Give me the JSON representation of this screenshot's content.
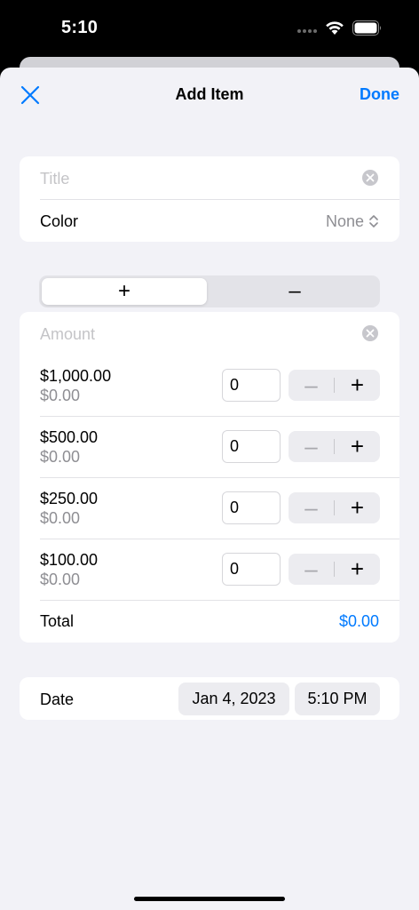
{
  "status_bar": {
    "time": "5:10"
  },
  "nav": {
    "title": "Add Item",
    "done_label": "Done"
  },
  "form": {
    "title_placeholder": "Title",
    "color_label": "Color",
    "color_value": "None"
  },
  "segmented": {
    "options": [
      "+",
      "–"
    ],
    "selected_index": 0
  },
  "amount": {
    "placeholder": "Amount",
    "rows": [
      {
        "denomination": "$1,000.00",
        "subtotal": "$0.00",
        "quantity": "0"
      },
      {
        "denomination": "$500.00",
        "subtotal": "$0.00",
        "quantity": "0"
      },
      {
        "denomination": "$250.00",
        "subtotal": "$0.00",
        "quantity": "0"
      },
      {
        "denomination": "$100.00",
        "subtotal": "$0.00",
        "quantity": "0"
      }
    ],
    "stepper_minus": "–",
    "stepper_plus": "+",
    "total_label": "Total",
    "total_value": "$0.00"
  },
  "date_section": {
    "label": "Date",
    "date": "Jan 4, 2023",
    "time": "5:10 PM"
  },
  "colors": {
    "accent": "#007aff",
    "background": "#f2f2f7",
    "placeholder": "#c4c4c7",
    "secondary_text": "#8e8e93"
  }
}
